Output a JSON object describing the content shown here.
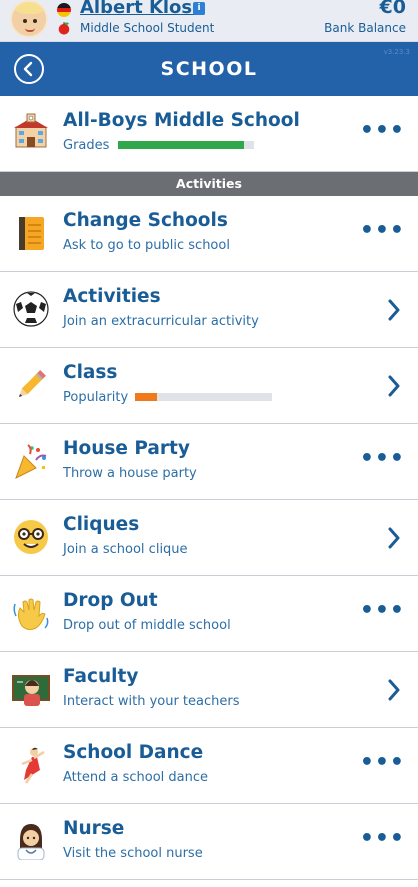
{
  "player": {
    "name": "Albert Klose",
    "info_badge": "i",
    "occupation": "Middle School Student",
    "balance": "€0",
    "balance_label": "Bank Balance"
  },
  "header": {
    "title": "SCHOOL",
    "version": "v3.23.3"
  },
  "school": {
    "name": "All-Boys Middle School",
    "grades_label": "Grades",
    "grades_level": 0.93,
    "more": "•••"
  },
  "section_title": "Activities",
  "activities": [
    {
      "title": "Change Schools",
      "subtitle": "Ask to go to public school",
      "action": "more",
      "icon": "notebook-icon"
    },
    {
      "title": "Activities",
      "subtitle": "Join an extracurricular activity",
      "action": "chevron",
      "icon": "soccer-ball-icon"
    },
    {
      "title": "Class",
      "subtitle": "Popularity",
      "action": "chevron",
      "icon": "pencil-icon",
      "popularity_level": 0.16
    },
    {
      "title": "House Party",
      "subtitle": "Throw a house party",
      "action": "more",
      "icon": "party-popper-icon"
    },
    {
      "title": "Cliques",
      "subtitle": "Join a school clique",
      "action": "chevron",
      "icon": "nerd-face-icon"
    },
    {
      "title": "Drop Out",
      "subtitle": "Drop out of middle school",
      "action": "more",
      "icon": "waving-hand-icon"
    },
    {
      "title": "Faculty",
      "subtitle": "Interact with your teachers",
      "action": "chevron",
      "icon": "teacher-icon"
    },
    {
      "title": "School Dance",
      "subtitle": "Attend a school dance",
      "action": "more",
      "icon": "dancer-icon"
    },
    {
      "title": "Nurse",
      "subtitle": "Visit the school nurse",
      "action": "more",
      "icon": "nurse-icon"
    }
  ],
  "colors": {
    "header_blue": "#2361a8",
    "text_blue": "#1a5d96",
    "grades_green": "#2ea84a",
    "popularity_orange": "#f07a1a",
    "section_gray": "#6b6f73"
  }
}
